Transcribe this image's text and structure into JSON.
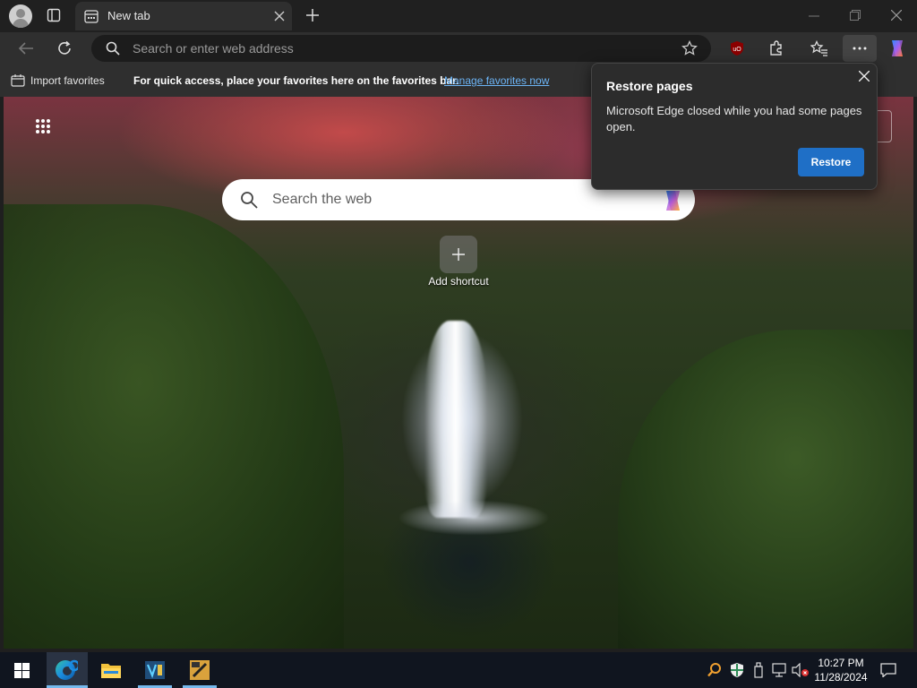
{
  "window": {
    "tab_title": "New tab",
    "address_placeholder": "Search or enter web address"
  },
  "favorites_bar": {
    "import_label": "Import favorites",
    "hint_text": "For quick access, place your favorites here on the favorites bar.",
    "manage_link": "Manage favorites now"
  },
  "new_tab_page": {
    "search_placeholder": "Search the web",
    "add_shortcut_label": "Add shortcut"
  },
  "restore_popup": {
    "title": "Restore pages",
    "message": "Microsoft Edge closed while you had some pages open.",
    "button_label": "Restore"
  },
  "taskbar": {
    "time": "10:27 PM",
    "date": "11/28/2024"
  },
  "icons": [
    "profile-icon",
    "workspaces-icon",
    "new-tab-icon",
    "minimize-icon",
    "restore-window-icon",
    "close-window-icon",
    "back-icon",
    "refresh-icon",
    "search-icon",
    "favorite-star-icon",
    "ublock-icon",
    "extensions-icon",
    "favorites-icon",
    "more-options-icon",
    "copilot-icon",
    "app-launcher-icon",
    "start-icon",
    "edge-icon",
    "file-explorer-icon"
  ],
  "colors": {
    "accent_blue": "#1f6fc6",
    "link_blue": "#6cb4f5",
    "tab_bg": "#2f2f2f",
    "titlebar_bg": "#202020",
    "taskbar_bg": "#10151f"
  }
}
